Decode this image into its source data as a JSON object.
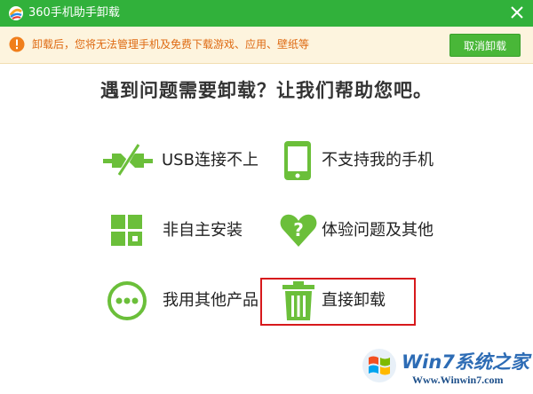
{
  "window": {
    "title": "360手机助手卸载"
  },
  "notice": {
    "text": "卸载后，您将无法管理手机及免费下载游戏、应用、壁纸等",
    "cancel_label": "取消卸载"
  },
  "heading": "遇到问题需要卸载？让我们帮助您吧。",
  "options": [
    {
      "label": "USB连接不上",
      "icon": "usb-disconnected-icon"
    },
    {
      "label": "不支持我的手机",
      "icon": "phone-icon"
    },
    {
      "label": "非自主安装",
      "icon": "app-grid-icon"
    },
    {
      "label": "体验问题及其他",
      "icon": "heart-question-icon"
    },
    {
      "label": "我用其他产品",
      "icon": "more-dots-icon"
    },
    {
      "label": "直接卸载",
      "icon": "trash-icon"
    }
  ],
  "watermark": {
    "title": "Win7系统之家",
    "url": "Www.Winwin7.com"
  },
  "colors": {
    "brand_green": "#31b13b",
    "icon_green": "#6bbf3a",
    "notice_orange": "#de6a12",
    "highlight_red": "#d7191c"
  }
}
